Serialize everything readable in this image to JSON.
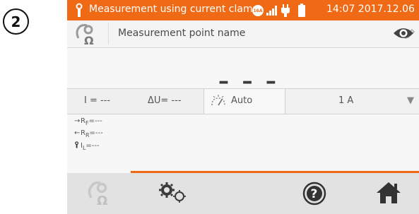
{
  "step_number": "2",
  "status_bar": {
    "title": "Measurement using current clamp",
    "clamp_badge": "16A",
    "datetime": "14:07 2017.12.06",
    "icons": [
      "probe-icon",
      "clamp-icon",
      "signal-icon",
      "plug-icon",
      "battery-icon"
    ]
  },
  "measurement_point": {
    "label": "Measurement point name",
    "icons": [
      "probe-ohm-icon",
      "pencil-icon",
      "eye-icon"
    ]
  },
  "main_value": "– – –",
  "params": {
    "current": "I = ---",
    "voltage_drop": "ΔU= ---",
    "mode": "Auto",
    "range": "1 A",
    "range_arrow": "▼"
  },
  "results": {
    "rf_arrow": "→",
    "rf": "R",
    "rf_sub": "F",
    "rf_val": "=---",
    "rr_arrow": "←",
    "rr": "R",
    "rr_sub": "R",
    "rr_val": "=---",
    "il": "I",
    "il_sub": "L",
    "il_val": "=---"
  },
  "bottom_bar": {
    "buttons": [
      "probe-ohm-icon",
      "settings-gears-icon",
      "help-icon",
      "home-icon"
    ]
  },
  "colors": {
    "accent": "#f06a16",
    "bottom_bar": "#e2e2e2",
    "text": "#555555"
  }
}
